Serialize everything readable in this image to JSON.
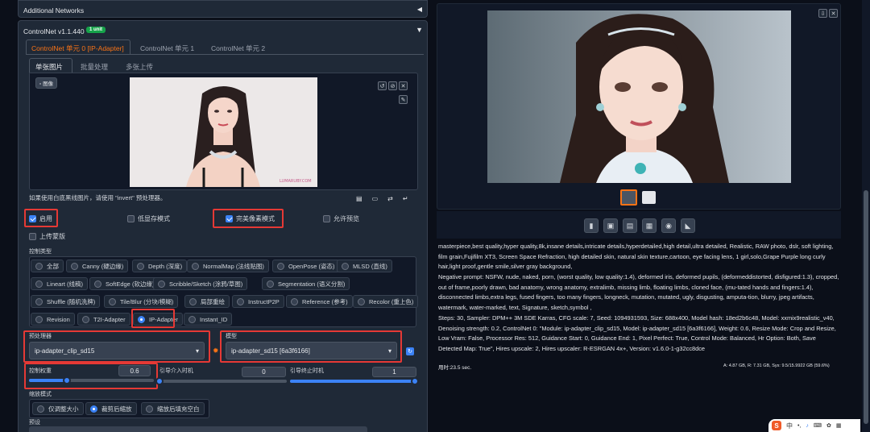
{
  "accordion": {
    "title": "Additional Networks",
    "toggle": "◀"
  },
  "controlnet": {
    "title": "ControlNet v1.1.440",
    "badge": "1 unit",
    "toggle": "▼",
    "unit_tabs": [
      "ControlNet 单元 0 [IP-Adapter]",
      "ControlNet 单元 1",
      "ControlNet 单元 2"
    ],
    "image_tabs": [
      "单张图片",
      "批量处理",
      "多张上传"
    ],
    "image_label": "图像",
    "invert_hint": "如果使用白底黑线图片，请使用 \"invert\" 预处理器。",
    "options": {
      "enable": "启用",
      "low_vram": "低显存模式",
      "pixel_perfect": "完美像素模式",
      "allow_preview": "允许预览",
      "upload_mask": "上传蒙版"
    },
    "control_type_label": "控制类型",
    "control_types": [
      "全部",
      "Canny (硬边缘)",
      "Depth (深度)",
      "NormalMap (法线贴图)",
      "OpenPose (姿态)",
      "MLSD (直线)",
      "Lineart (线稿)",
      "SoftEdge (软边缘)",
      "Scribble/Sketch (涂鸦/草图)",
      "Segmentation (语义分割)",
      "Shuffle (随机洗牌)",
      "Tile/Blur (分块/模糊)",
      "局部重绘",
      "InstructP2P",
      "Reference (参考)",
      "Recolor (重上色)",
      "Revision",
      "T2I-Adapter",
      "IP-Adapter",
      "Instant_ID"
    ],
    "selected_type": "IP-Adapter",
    "preprocessor_label": "预处理器",
    "preprocessor_value": "ip-adapter_clip_sd15",
    "model_label": "模型",
    "model_value": "ip-adapter_sd15 [6a3f6166]",
    "weight_label": "控制权重",
    "weight_value": "0.6",
    "weight": 0.6,
    "start_label": "引导介入时机",
    "start_value": "0",
    "start": 0,
    "end_label": "引导终止时机",
    "end_value": "1",
    "end": 1,
    "resize_label": "缩放模式",
    "resize_modes": [
      "仅调整大小",
      "裁剪后缩放",
      "缩放后填充空白"
    ],
    "resize_selected": "裁剪后缩放",
    "preset_label": "预设"
  },
  "output": {
    "prompt": "masterpiece,best quality,hyper quality,8k,insane details,intricate details,hyperdetailed,high detail,ultra detailed, Realistic, RAW photo, dslr, soft lighting, film grain,Fujifilm XT3, Screen Space Refraction, high detailed skin, natural skin texture,cartoon, eye facing lens, 1 girl,solo,Grape Purple long curly hair,light proof,gentle smile,silver gray background,",
    "negative": "Negative prompt: NSFW, nude, naked, porn, (worst quality, low quality:1.4), deformed iris, deformed pupils, (deformeddistorted, disfigured:1.3), cropped, out of frame,poorly drawn, bad anatomy, wrong anatomy, extralimb, missing limb, floating limbs, cloned face, (mu-tated hands and fingers:1.4), disconnected limbs,extra legs, fused fingers, too many fingers, longneck, mutation, mutated, ugly, disgusting, amputa-tion, blurry, jpeg artifacts, watermark, water-marked, text, Signature, sketch,symbol ,",
    "params": "Steps: 30, Sampler: DPM++ 3M SDE Karras, CFG scale: 7, Seed: 1094931593, Size: 688x400, Model hash: 18ed2b6c48, Model: xxmix9realistic_v40, Denoising strength: 0.2, ControlNet 0: \"Module: ip-adapter_clip_sd15, Model: ip-adapter_sd15 [6a3f6166], Weight: 0.6, Resize Mode: Crop and Resize, Low Vram: False, Processor Res: 512, Guidance Start: 0, Guidance End: 1, Pixel Perfect: True, Control Mode: Balanced, Hr Option: Both, Save Detected Map: True\", Hires upscale: 2, Hires upscaler: R-ESRGAN 4x+, Version: v1.6.0-1-g32cc8dce",
    "time": "用时:23.5 sec.",
    "vram": "A: 4.87 GB, R: 7.31 GB, Sys: 9.5/15.9922 GB (59.6%)",
    "tool_icons": [
      "folder-icon",
      "save-icon",
      "zip-icon",
      "image-icon",
      "palette-icon",
      "ruler-icon"
    ]
  },
  "ime": {
    "logo": "S",
    "label": "中"
  }
}
